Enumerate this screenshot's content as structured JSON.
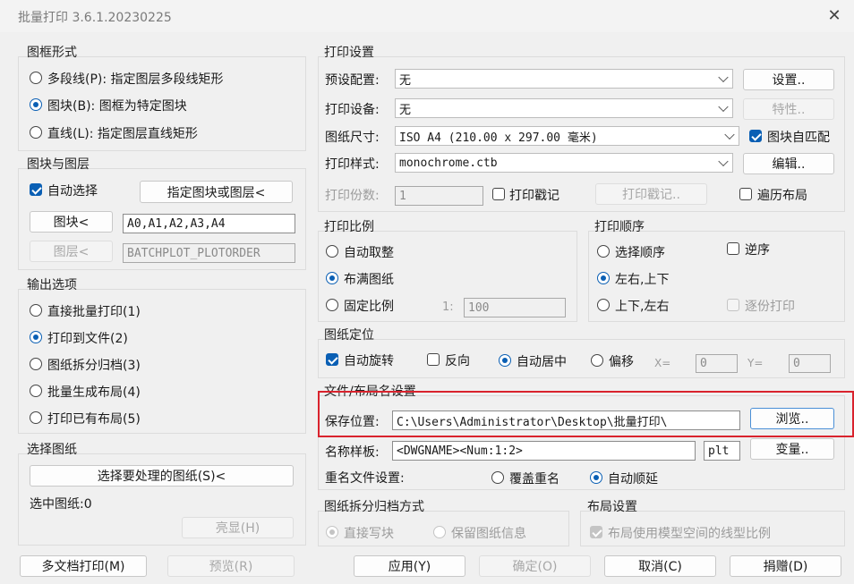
{
  "window": {
    "title": "批量打印 3.6.1.20230225",
    "close_glyph": "✕"
  },
  "frame_form": {
    "title": "图框形式",
    "options": [
      {
        "label": "多段线(P): 指定图层多段线矩形",
        "selected": false
      },
      {
        "label": "图块(B): 图框为特定图块",
        "selected": true
      },
      {
        "label": "直线(L): 指定图层直线矩形",
        "selected": false
      }
    ]
  },
  "block_layer": {
    "title": "图块与图层",
    "auto_select_label": "自动选择",
    "auto_select_checked": true,
    "pick_button": "指定图块或图层<",
    "block_button": "图块<",
    "block_value": "A0,A1,A2,A3,A4",
    "layer_button": "图层<",
    "layer_value": "BATCHPLOT_PLOTORDER"
  },
  "output": {
    "title": "输出选项",
    "options": [
      {
        "label": "直接批量打印(1)",
        "selected": false
      },
      {
        "label": "打印到文件(2)",
        "selected": true
      },
      {
        "label": "图纸拆分归档(3)",
        "selected": false
      },
      {
        "label": "批量生成布局(4)",
        "selected": false
      },
      {
        "label": "打印已有布局(5)",
        "selected": false
      }
    ]
  },
  "select_drawing": {
    "title": "选择图纸",
    "select_button": "选择要处理的图纸(S)<",
    "selected_label": "选中图纸:0",
    "highlight_button": "亮显(H)"
  },
  "print_settings": {
    "title": "打印设置",
    "preset_label": "预设配置:",
    "preset_value": "无",
    "setup_button": "设置..",
    "device_label": "打印设备:",
    "device_value": "无",
    "props_button": "特性..",
    "paper_label": "图纸尺寸:",
    "paper_value": "ISO A4 (210.00 x 297.00 毫米)",
    "block_fit_label": "图块自匹配",
    "block_fit_checked": true,
    "style_label": "打印样式:",
    "style_value": "monochrome.ctb",
    "edit_button": "编辑..",
    "copies_label": "打印份数:",
    "copies_value": "1",
    "stamp_label": "打印戳记",
    "stamp_checked": false,
    "stamp_button": "打印戳记..",
    "traverse_label": "遍历布局",
    "traverse_checked": false
  },
  "scale": {
    "title": "打印比例",
    "options": [
      {
        "label": "自动取整",
        "selected": false
      },
      {
        "label": "布满图纸",
        "selected": true
      },
      {
        "label": "固定比例",
        "selected": false
      }
    ],
    "ratio_prefix": "1:",
    "ratio_value": "100"
  },
  "order": {
    "title": "打印顺序",
    "options": [
      {
        "label": "选择顺序",
        "selected": false
      },
      {
        "label": "左右,上下",
        "selected": true
      },
      {
        "label": "上下,左右",
        "selected": false
      }
    ],
    "reverse_label": "逆序",
    "reverse_checked": false,
    "collate_label": "逐份打印",
    "collate_checked": false
  },
  "position": {
    "title": "图纸定位",
    "auto_rotate_label": "自动旋转",
    "auto_rotate_checked": true,
    "invert_label": "反向",
    "invert_checked": false,
    "center_label": "自动居中",
    "offset_label": "偏移",
    "x_label": "X=",
    "x_value": "0",
    "y_label": "Y=",
    "y_value": "0"
  },
  "file": {
    "title": "文件/布局名设置",
    "save_label": "保存位置:",
    "save_path": "C:\\Users\\Administrator\\Desktop\\批量打印\\",
    "browse_button": "浏览..",
    "name_label": "名称样板:",
    "name_template": "<DWGNAME><Num:1:2>",
    "ext_value": "plt",
    "var_button": "变量..",
    "rename_label": "重名文件设置:",
    "overwrite_label": "覆盖重名",
    "auto_label": "自动顺延"
  },
  "archive": {
    "title": "图纸拆分归档方式",
    "direct_label": "直接写块",
    "keep_label": "保留图纸信息"
  },
  "layout": {
    "title": "布局设置",
    "model_lt_label": "布局使用模型空间的线型比例",
    "model_lt_checked": true
  },
  "footer": {
    "multi": "多文档打印(M)",
    "preview": "预览(R)",
    "apply": "应用(Y)",
    "ok": "确定(O)",
    "cancel": "取消(C)",
    "donate": "捐赠(D)"
  }
}
